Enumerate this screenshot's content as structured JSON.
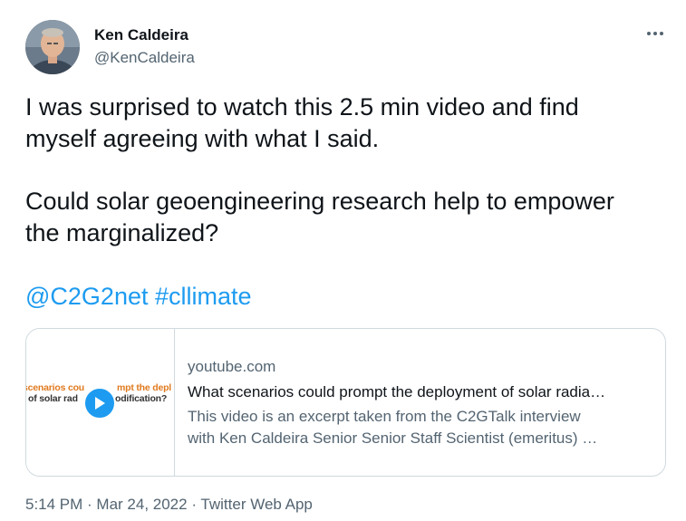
{
  "author": {
    "name": "Ken Caldeira",
    "handle": "@KenCaldeira"
  },
  "menu": {
    "icon": "more-horizontal-icon"
  },
  "tweet": {
    "line1": "I was surprised to watch this 2.5 min video and find",
    "line2": "myself agreeing with what I said.",
    "line3": "Could solar geoengineering research help to empower",
    "line4": "the marginalized?",
    "mention": "@C2G2net",
    "hashtag": "#cllimate"
  },
  "card": {
    "thumbnail": {
      "left_line1": "scenarios cou",
      "left_line2": "of solar rad",
      "right_line1": "mpt the depl",
      "right_line2": "odification?",
      "play_icon": "play-icon"
    },
    "domain": "youtube.com",
    "title": "What scenarios could prompt the deployment of solar radia…",
    "description_line1": "This video is an excerpt taken from the C2GTalk interview",
    "description_line2": "with Ken Caldeira Senior Senior Staff Scientist (emeritus) …"
  },
  "meta": {
    "time": "5:14 PM",
    "separator1": " · ",
    "date": "Mar 24, 2022",
    "separator2": " · ",
    "source": "Twitter Web App"
  },
  "colors": {
    "link": "#1d9bf0",
    "secondary_text": "#536471",
    "primary_text": "#0f1419",
    "border": "#cfd9de"
  }
}
